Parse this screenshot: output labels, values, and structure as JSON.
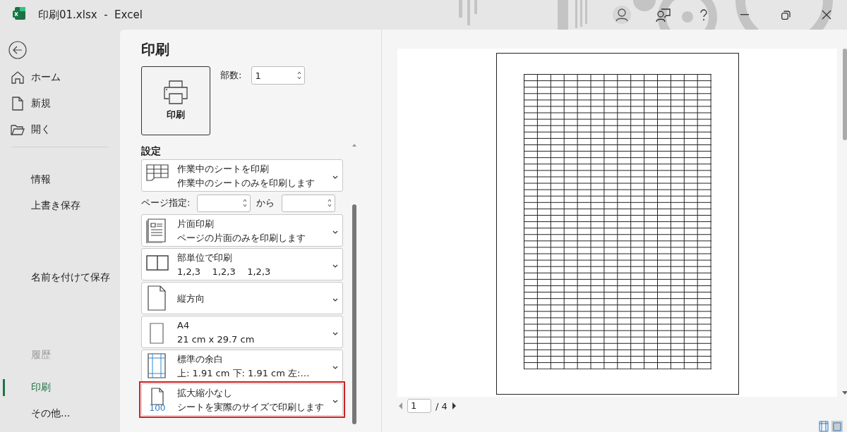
{
  "window": {
    "title": "印刷01.xlsx  -  Excel"
  },
  "sidebar": {
    "items": [
      {
        "label": "ホーム",
        "selected": false,
        "disabled": false
      },
      {
        "label": "新規",
        "selected": false,
        "disabled": false
      },
      {
        "label": "開く",
        "selected": false,
        "disabled": false
      },
      {
        "label": "情報",
        "selected": false,
        "disabled": false
      },
      {
        "label": "上書き保存",
        "selected": false,
        "disabled": false
      },
      {
        "label": "名前を付けて保存",
        "selected": false,
        "disabled": false
      },
      {
        "label": "履歴",
        "selected": false,
        "disabled": true
      },
      {
        "label": "印刷",
        "selected": true,
        "disabled": false
      },
      {
        "label": "その他...",
        "selected": false,
        "disabled": false
      }
    ]
  },
  "print": {
    "heading": "印刷",
    "button": "印刷",
    "copies": {
      "label": "部数:",
      "value": "1"
    }
  },
  "settings": {
    "heading": "設定",
    "page_range": {
      "label": "ページ指定:",
      "to": "から"
    },
    "options": [
      {
        "kind": "sheets",
        "title": "作業中のシートを印刷",
        "subtitle": "作業中のシートのみを印刷します",
        "highlighted": false
      },
      {
        "kind": "range"
      },
      {
        "kind": "onesided",
        "title": "片面印刷",
        "subtitle": "ページの片面のみを印刷します",
        "highlighted": false
      },
      {
        "kind": "collate",
        "title": "部単位で印刷",
        "subtitle": "1,2,3    1,2,3    1,2,3",
        "highlighted": false
      },
      {
        "kind": "portrait",
        "title": "縦方向",
        "highlighted": false
      },
      {
        "kind": "paper",
        "title": "A4",
        "subtitle": "21 cm x 29.7 cm",
        "highlighted": false
      },
      {
        "kind": "margins",
        "title": "標準の余白",
        "subtitle": "上: 1.91 cm 下: 1.91 cm 左:…",
        "highlighted": false
      },
      {
        "kind": "scaling",
        "title": "拡大縮小なし",
        "subtitle": "シートを実際のサイズで印刷します",
        "badge": "100",
        "highlighted": true
      }
    ]
  },
  "preview": {
    "page": "1",
    "total": "/ 4"
  }
}
